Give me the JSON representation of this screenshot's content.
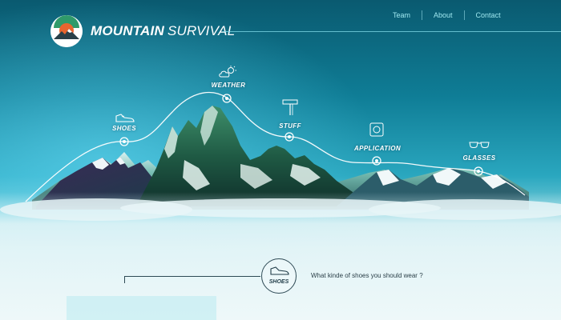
{
  "header": {
    "brand_bold": "MOUNTAIN",
    "brand_light": "SURVIVAL",
    "logo_icon": "mountain-sun-logo-icon"
  },
  "nav": {
    "items": [
      {
        "label": "Team"
      },
      {
        "label": "About"
      },
      {
        "label": "Contact"
      }
    ]
  },
  "waypoints": [
    {
      "label": "SHOES",
      "icon": "sneaker-icon"
    },
    {
      "label": "WEATHER",
      "icon": "cloud-sun-icon"
    },
    {
      "label": "STUFF",
      "icon": "ice-axe-icon"
    },
    {
      "label": "APPLICATION",
      "icon": "smartphone-app-icon"
    },
    {
      "label": "GLASSES",
      "icon": "sunglasses-icon"
    }
  ],
  "detail": {
    "selected_label": "SHOES",
    "question": "What kinde of shoes you should wear ?",
    "icon": "sneaker-icon"
  },
  "colors": {
    "accent": "#9fe8f0",
    "logo_orange": "#e8652f",
    "logo_green": "#2f9a6a",
    "text_dark": "#2a3f48"
  }
}
